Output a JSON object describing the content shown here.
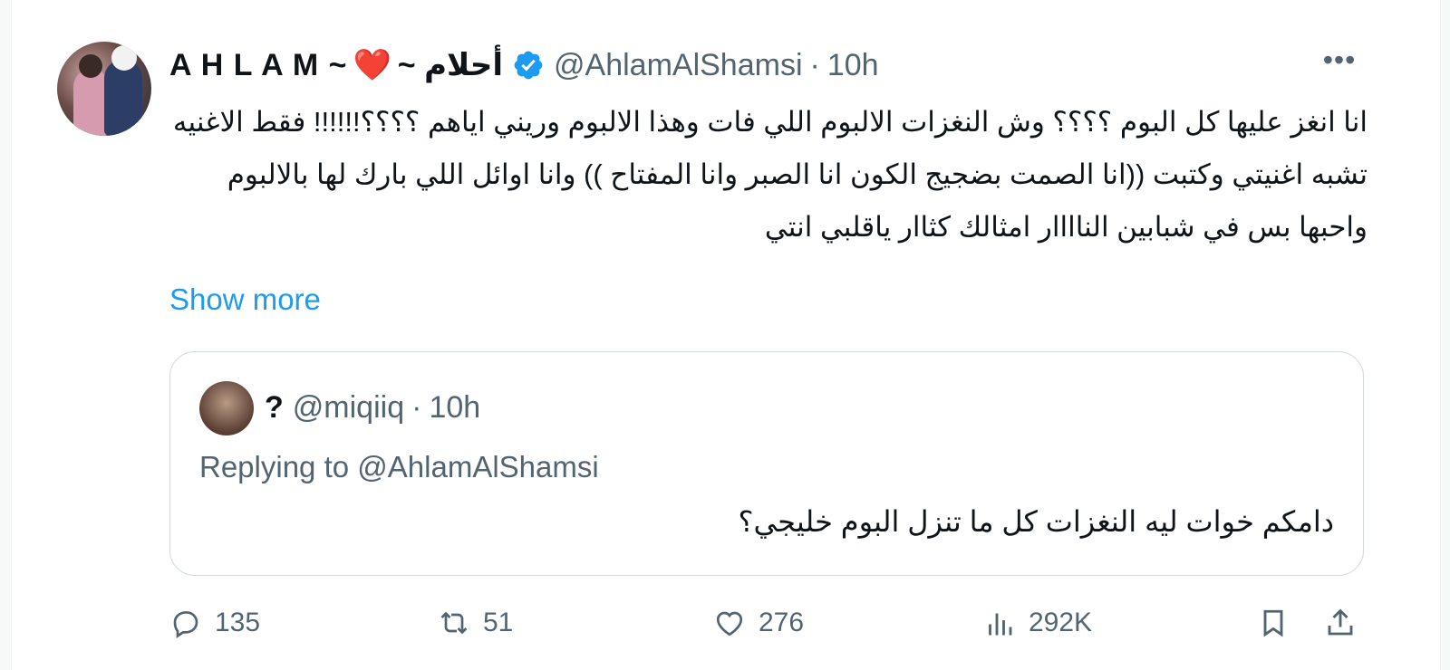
{
  "tweet": {
    "author_name": "A H L A M ~",
    "author_heart": "❤️",
    "author_arabic": "~ أحلام",
    "handle": "@AhlamAlShamsi",
    "time": "10h",
    "text": "انا انغز عليها كل البوم ؟؟؟؟ وش النغزات الالبوم اللي فات وهذا الالبوم وريني اياهم ؟؟؟؟!!!!!! فقط الاغنيه تشبه اغنيتي وكتبت ((انا الصمت بضجيج الكون انا الصبر وانا المفتاح )) وانا اوائل اللي بارك لها بالالبوم واحبها بس في شبابين الناااار امثالك كثاار ياقلبي انتي",
    "show_more": "Show more",
    "more_icon": "more-icon"
  },
  "quote": {
    "author_name": "?",
    "handle": "@miqiiq",
    "time": "10h",
    "replying_prefix": "Replying to",
    "replying_to": "@AhlamAlShamsi",
    "text": "دامكم خوات ليه النغزات كل ما تنزل البوم خليجي؟"
  },
  "actions": {
    "replies": "135",
    "retweets": "51",
    "likes": "276",
    "views": "292K"
  },
  "colors": {
    "accent": "#1d9bf0",
    "secondary_text": "#536471",
    "border": "#cfd9de",
    "heart": "#e0245e"
  }
}
